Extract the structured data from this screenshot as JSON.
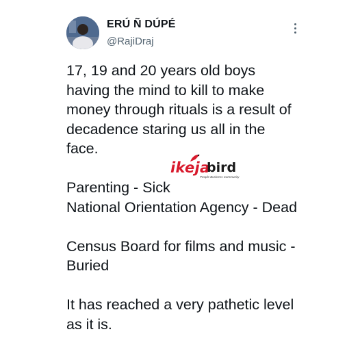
{
  "tweet": {
    "author": {
      "display_name": "ERÚ Ñ DÚPÉ",
      "handle": "@RajiDraj"
    },
    "paragraphs": [
      "17, 19 and 20 years old boys having the mind to kill to make money through rituals is a result of decadence staring us all in the face.",
      "Parenting - Sick",
      "National Orientation Agency - Dead",
      "Census Board for films and music - Buried",
      "It has reached a very pathetic level as it is."
    ]
  },
  "watermark": {
    "brand_left": "ikeja",
    "brand_right": "bird",
    "tagline": "People Business Community"
  },
  "icons": {
    "more": "more-vertical-icon",
    "avatar": "profile-photo"
  },
  "colors": {
    "text": "#0f1419",
    "secondary": "#536471",
    "watermark_red": "#d8192c"
  }
}
